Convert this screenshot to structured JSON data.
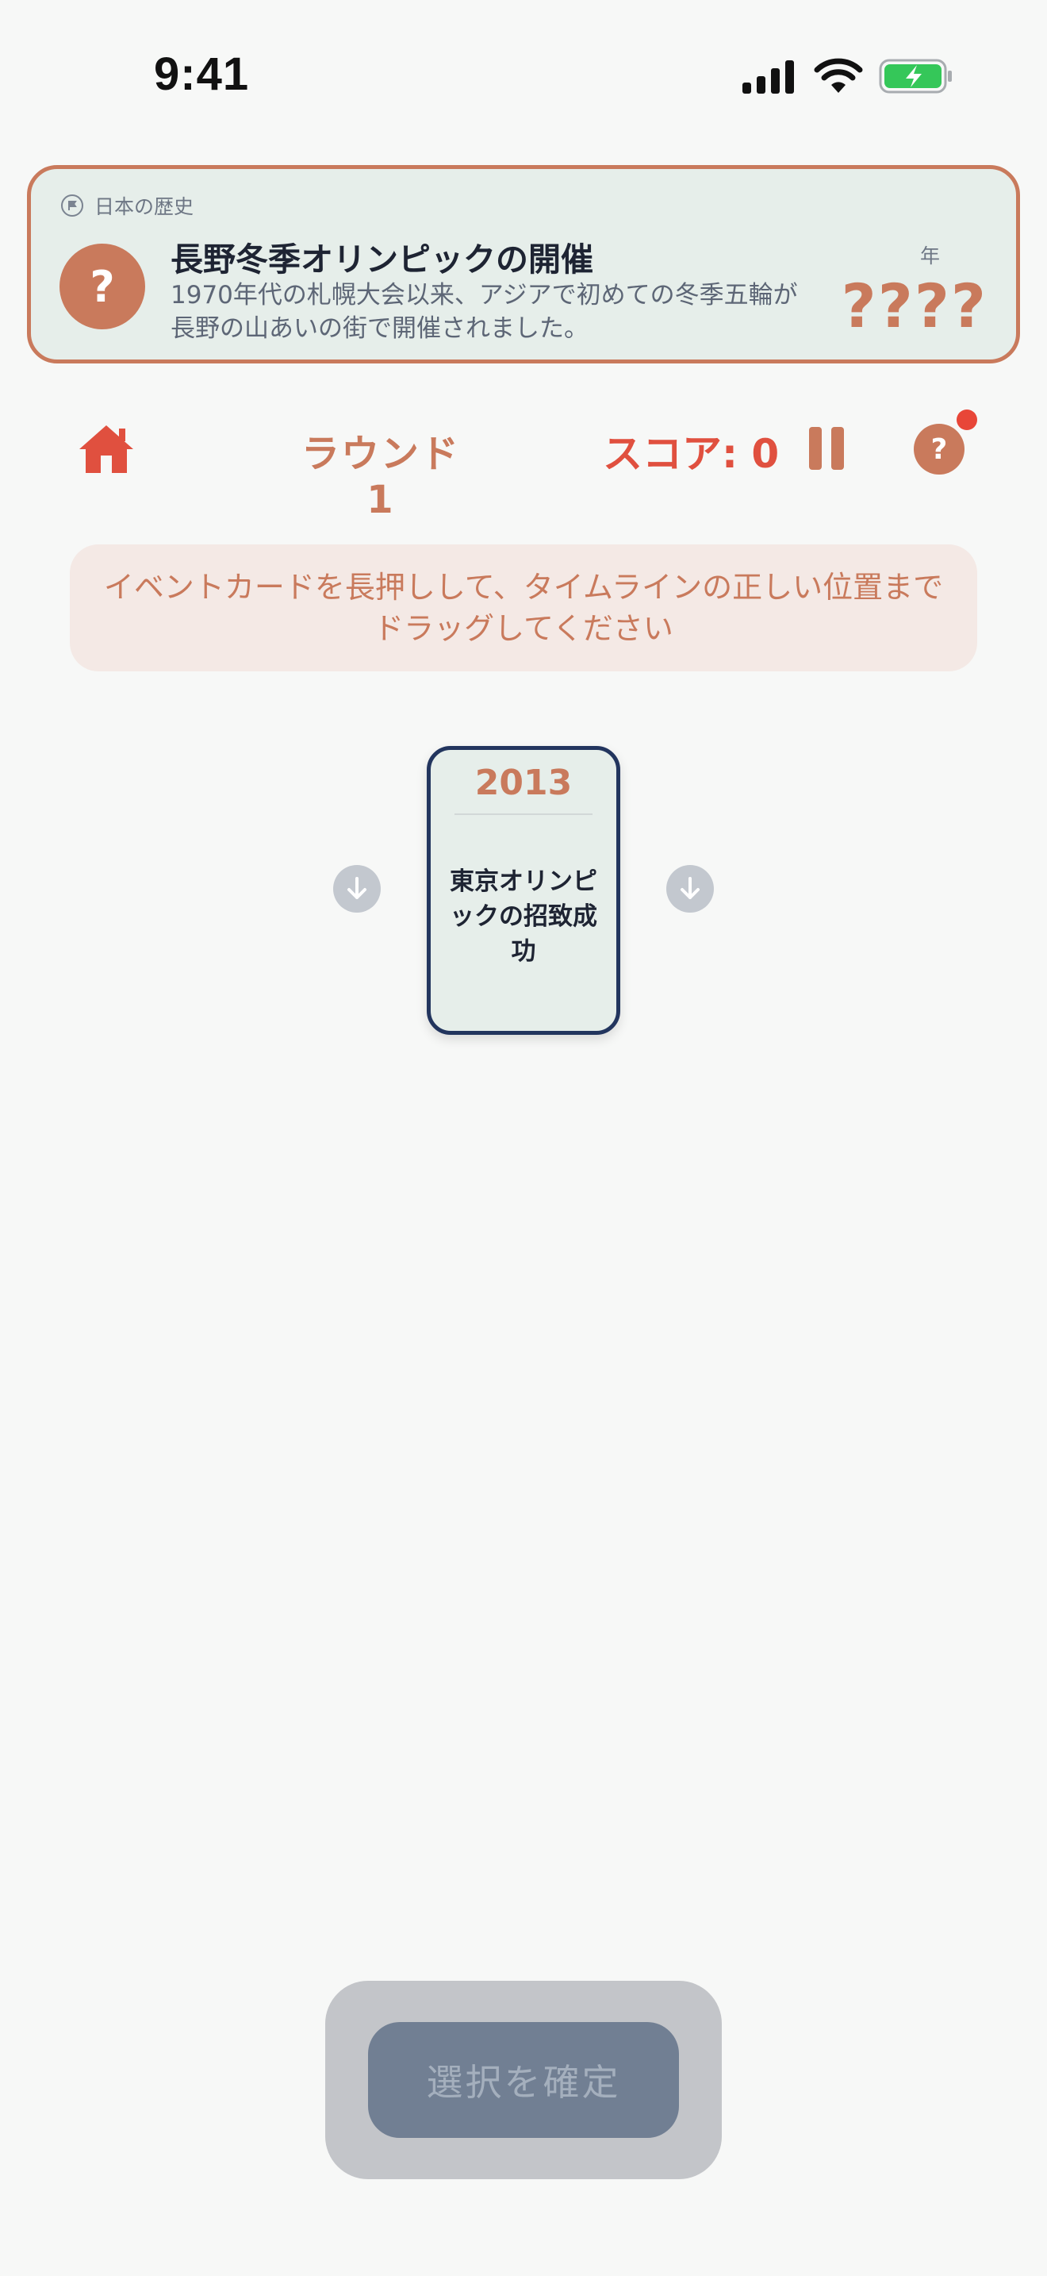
{
  "status_bar": {
    "time": "9:41"
  },
  "event": {
    "category": "日本の歴史",
    "title": "長野冬季オリンピックの開催",
    "description": "1970年代の札幌大会以来、アジアで初めての冬季五輪が長野の山あいの街で開催されました。",
    "year_label": "年",
    "year_value": "????",
    "hidden_mark": "?"
  },
  "toolbar": {
    "round": "ラウンド 1",
    "score": "スコア: 0",
    "help_mark": "?"
  },
  "instruction": "イベントカードを長押しして、タイムラインの正しい位置までドラッグしてください",
  "timeline": {
    "cards": [
      {
        "year": "2013",
        "text": "東京オリンピックの招致成功"
      }
    ]
  },
  "confirm_button": "選択を確定",
  "colors": {
    "accent": "#c97a5c",
    "alert_red": "#e0503f",
    "navy": "#22355e",
    "card_bg": "#e6eeea",
    "battery_green": "#35c759"
  }
}
